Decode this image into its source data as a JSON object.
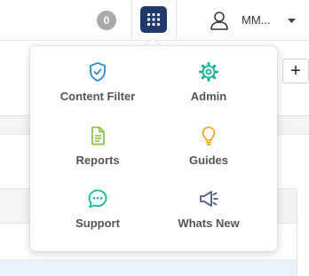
{
  "header": {
    "notification_count": "0",
    "user_name": "MM...",
    "apps_button_color": "#1f3a6e"
  },
  "apps_menu": {
    "items": [
      {
        "label": "Content Filter",
        "icon": "shield-check-icon",
        "color": "#2c8fd6"
      },
      {
        "label": "Admin",
        "icon": "gear-icon",
        "color": "#18b59a"
      },
      {
        "label": "Reports",
        "icon": "document-icon",
        "color": "#8cc24a"
      },
      {
        "label": "Guides",
        "icon": "lightbulb-icon",
        "color": "#f0a81a"
      },
      {
        "label": "Support",
        "icon": "chat-bubble-icon",
        "color": "#18b59a"
      },
      {
        "label": "Whats New",
        "icon": "megaphone-icon",
        "color": "#4a5a8c"
      }
    ]
  },
  "toolbar": {
    "add_label": "+"
  }
}
